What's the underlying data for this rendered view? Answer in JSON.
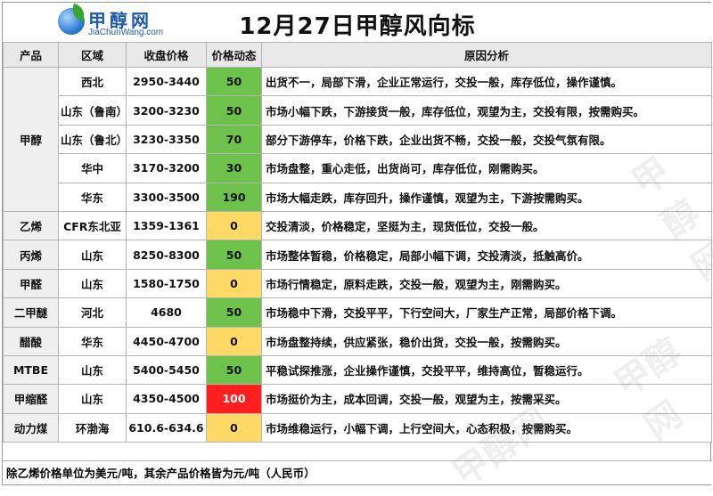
{
  "title": "12月27日甲醇风向标",
  "logo": {
    "cn": "甲醇网",
    "en": "JiaChunWang.com"
  },
  "watermark": "甲醇网",
  "columns": [
    "产品",
    "区域",
    "收盘价格",
    "价格动态",
    "原因分析"
  ],
  "rows": [
    {
      "product": "甲醇",
      "rowspan": 5,
      "region": "西北",
      "price": "2950-3440",
      "dyn": "50",
      "dyn_color": "green",
      "reason": "出货不一，局部下滑，企业正常运行，交投一般，库存低位，操作谨慎。"
    },
    {
      "product": null,
      "region": "山东（鲁南）",
      "price": "3200-3230",
      "dyn": "50",
      "dyn_color": "green",
      "reason": "市场小幅下跌，下游接货一般，库存低位，观望为主，交投有限，按需购买。"
    },
    {
      "product": null,
      "region": "山东（鲁北）",
      "price": "3230-3350",
      "dyn": "70",
      "dyn_color": "green",
      "reason": "部分下游停车，价格下跌，企业出货不畅，交投一般，交投气氛有限。"
    },
    {
      "product": null,
      "region": "华中",
      "price": "3170-3200",
      "dyn": "30",
      "dyn_color": "green",
      "reason": "市场盘整，重心走低，出货尚可，库存低位，刚需购买。"
    },
    {
      "product": null,
      "region": "华东",
      "price": "3300-3500",
      "dyn": "190",
      "dyn_color": "green",
      "reason": "市场大幅走跌，库存回升，操作谨慎，观望为主，下游按需购买。"
    },
    {
      "product": "乙烯",
      "rowspan": 1,
      "region": "CFR东北亚",
      "price": "1359-1361",
      "dyn": "0",
      "dyn_color": "yellow",
      "reason": "交投清淡，价格稳定，坚挺为主，现货低位，交投一般。"
    },
    {
      "product": "丙烯",
      "rowspan": 1,
      "region": "山东",
      "price": "8250-8300",
      "dyn": "50",
      "dyn_color": "green",
      "reason": "市场整体暂稳，价格稳定，局部小幅下调，交投清淡，抵触高价。"
    },
    {
      "product": "甲醛",
      "rowspan": 1,
      "region": "山东",
      "price": "1580-1750",
      "dyn": "0",
      "dyn_color": "yellow",
      "reason": "市场行情稳定，原料走跌，交投一般，观望为主，刚需购买。"
    },
    {
      "product": "二甲醚",
      "rowspan": 1,
      "region": "河北",
      "price": "4680",
      "dyn": "50",
      "dyn_color": "green",
      "reason": "市场稳中下滑，交投平平，下行空间大，厂家生产正常，局部价格下调。"
    },
    {
      "product": "醋酸",
      "rowspan": 1,
      "region": "华东",
      "price": "4450-4700",
      "dyn": "0",
      "dyn_color": "yellow",
      "reason": "市场盘整持续，供应紧张，稳价出货，交投一般，按需购买。"
    },
    {
      "product": "MTBE",
      "rowspan": 1,
      "region": "山东",
      "price": "5400-5450",
      "dyn": "50",
      "dyn_color": "green",
      "reason": "平稳试探推涨，企业操作谨慎，交投平平，维持高位，暂稳运行。"
    },
    {
      "product": "甲缩醛",
      "rowspan": 1,
      "region": "山东",
      "price": "4350-4500",
      "dyn": "100",
      "dyn_color": "red",
      "reason": "市场挺价为主，成本回调，交投一般，观望为主，按需采买。"
    },
    {
      "product": "动力煤",
      "rowspan": 1,
      "region": "环渤海",
      "price": "610.6-634.6",
      "dyn": "0",
      "dyn_color": "yellow",
      "reason": "市场维稳运行，小幅下调，上行空间大，心态积极，按需购买。"
    }
  ],
  "footer": "除乙烯价格单位为美元/吨，其余产品价格皆为元/吨（人民币）",
  "colors": {
    "green": "#6cc24a",
    "yellow": "#ffd966",
    "red": "#ff1f1f"
  }
}
